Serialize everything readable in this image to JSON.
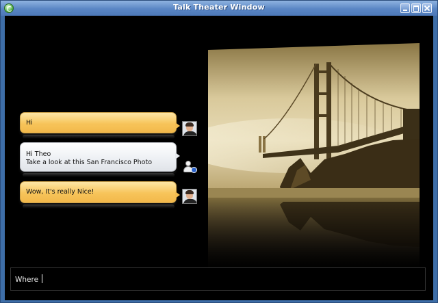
{
  "window": {
    "title": "Talk Theater Window"
  },
  "messages": [
    {
      "text": "Hi",
      "style": "yellow",
      "avatar": "contact-photo"
    },
    {
      "lines": [
        "Hi Theo",
        "Take a look at this San Francisco Photo"
      ],
      "style": "white",
      "avatar": "user-info-icon"
    },
    {
      "text": "Wow, It's really Nice!",
      "style": "yellow",
      "avatar": "contact-photo"
    }
  ],
  "input": {
    "value": "Where"
  },
  "colors": {
    "titlebar": "#5a86c4",
    "bubble_yellow": "#f7c45a",
    "bubble_white": "#eceff3",
    "photo_tone": "#c8b27a"
  }
}
